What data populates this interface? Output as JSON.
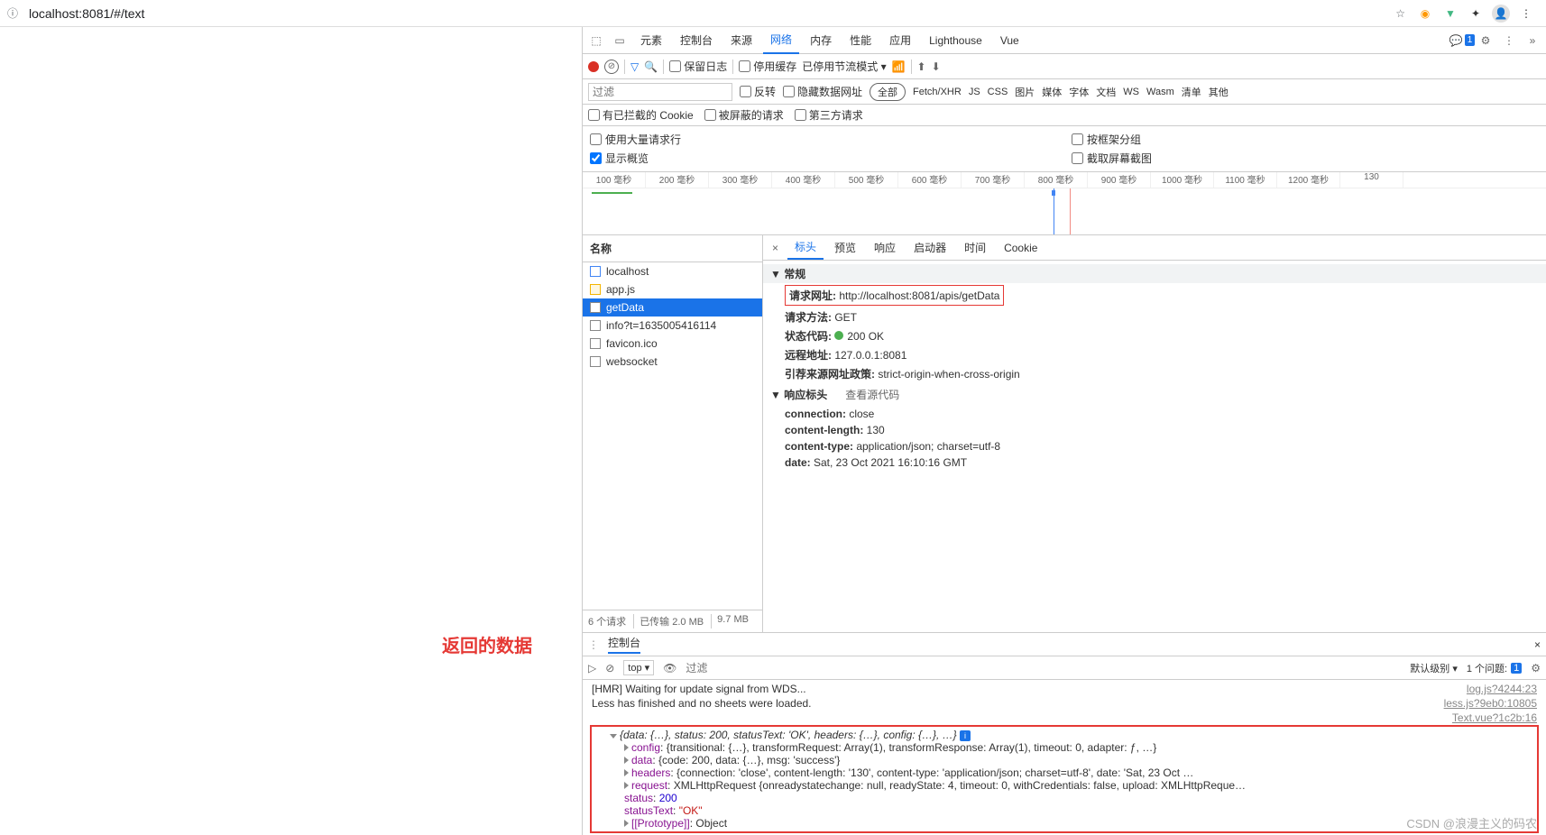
{
  "browser": {
    "url": "localhost:8081/#/text"
  },
  "devtools": {
    "tabs": [
      "元素",
      "控制台",
      "来源",
      "网络",
      "内存",
      "性能",
      "应用",
      "Lighthouse",
      "Vue"
    ],
    "active_tab": "网络",
    "msg_count": "1"
  },
  "toolbar": {
    "preserve": "保留日志",
    "disable_cache": "停用缓存",
    "throttle": "已停用节流模式"
  },
  "filter": {
    "placeholder": "过滤",
    "invert": "反转",
    "hide_data": "隐藏数据网址",
    "all": "全部",
    "types": [
      "Fetch/XHR",
      "JS",
      "CSS",
      "图片",
      "媒体",
      "字体",
      "文档",
      "WS",
      "Wasm",
      "清单",
      "其他"
    ]
  },
  "cookie_row": {
    "blocked": "有已拦截的 Cookie",
    "blocked_req": "被屏蔽的请求",
    "third_party": "第三方请求"
  },
  "opts": {
    "large_rows": "使用大量请求行",
    "frame_group": "按框架分组",
    "show_overview": "显示概览",
    "screenshot": "截取屏幕截图"
  },
  "timeline_ticks": [
    "100 毫秒",
    "200 毫秒",
    "300 毫秒",
    "400 毫秒",
    "500 毫秒",
    "600 毫秒",
    "700 毫秒",
    "800 毫秒",
    "900 毫秒",
    "1000 毫秒",
    "1100 毫秒",
    "1200 毫秒",
    "130"
  ],
  "netlist": {
    "header": "名称",
    "items": [
      {
        "name": "localhost",
        "icon": "doc"
      },
      {
        "name": "app.js",
        "icon": "js"
      },
      {
        "name": "getData",
        "icon": "xhr"
      },
      {
        "name": "info?t=1635005416114",
        "icon": "xhr"
      },
      {
        "name": "favicon.ico",
        "icon": "img"
      },
      {
        "name": "websocket",
        "icon": "ws"
      }
    ],
    "active": 2,
    "footer": {
      "reqs": "6 个请求",
      "xfer": "已传输 2.0 MB",
      "res": "9.7 MB"
    }
  },
  "netdetail": {
    "tabs": [
      "标头",
      "预览",
      "响应",
      "启动器",
      "时间",
      "Cookie"
    ],
    "active": "标头",
    "general_title": "常规",
    "general": [
      {
        "k": "请求网址:",
        "v": "http://localhost:8081/apis/getData",
        "boxed": true
      },
      {
        "k": "请求方法:",
        "v": "GET"
      },
      {
        "k": "状态代码:",
        "v": "200 OK",
        "dot": true
      },
      {
        "k": "远程地址:",
        "v": "127.0.0.1:8081"
      },
      {
        "k": "引荐来源网址政策:",
        "v": "strict-origin-when-cross-origin"
      }
    ],
    "resp_title": "响应标头",
    "resp_view_source": "查看源代码",
    "resp_headers": [
      {
        "k": "connection:",
        "v": "close"
      },
      {
        "k": "content-length:",
        "v": "130"
      },
      {
        "k": "content-type:",
        "v": "application/json; charset=utf-8"
      },
      {
        "k": "date:",
        "v": "Sat, 23 Oct 2021 16:10:16 GMT"
      }
    ]
  },
  "console": {
    "tab": "控制台",
    "top": "top ▾",
    "filter_ph": "过滤",
    "level": "默认级别 ▾",
    "issues_label": "1 个问题:",
    "issues_count": "1",
    "lines": [
      {
        "msg": "[HMR] Waiting for update signal from WDS...",
        "src": "log.js?4244:23"
      },
      {
        "msg": "Less has finished and no sheets were loaded.",
        "src": "less.js?9eb0:10805"
      },
      {
        "msg": "",
        "src": "Text.vue?1c2b:16"
      }
    ],
    "obj_summary": "{data: {…}, status: 200, statusText: 'OK', headers: {…}, config: {…}, …}",
    "expanded": [
      {
        "k": "config",
        "v": "{transitional: {…}, transformRequest: Array(1), transformResponse: Array(1), timeout: 0, adapter: ƒ, …}",
        "arrow": true
      },
      {
        "k": "data",
        "v": "{code: 200, data: {…}, msg: 'success'}",
        "arrow": true
      },
      {
        "k": "headers",
        "v": "{connection: 'close', content-length: '130', content-type: 'application/json; charset=utf-8', date: 'Sat, 23 Oct …",
        "arrow": true
      },
      {
        "k": "request",
        "v": "XMLHttpRequest {onreadystatechange: null, readyState: 4, timeout: 0, withCredentials: false, upload: XMLHttpReque…",
        "arrow": true
      },
      {
        "k": "status",
        "v": "200",
        "num": true
      },
      {
        "k": "statusText",
        "v": "\"OK\"",
        "str": true
      },
      {
        "k": "[[Prototype]]",
        "v": "Object",
        "arrow": true
      }
    ]
  },
  "annotation": "返回的数据",
  "watermark": "CSDN @浪漫主义的码农"
}
